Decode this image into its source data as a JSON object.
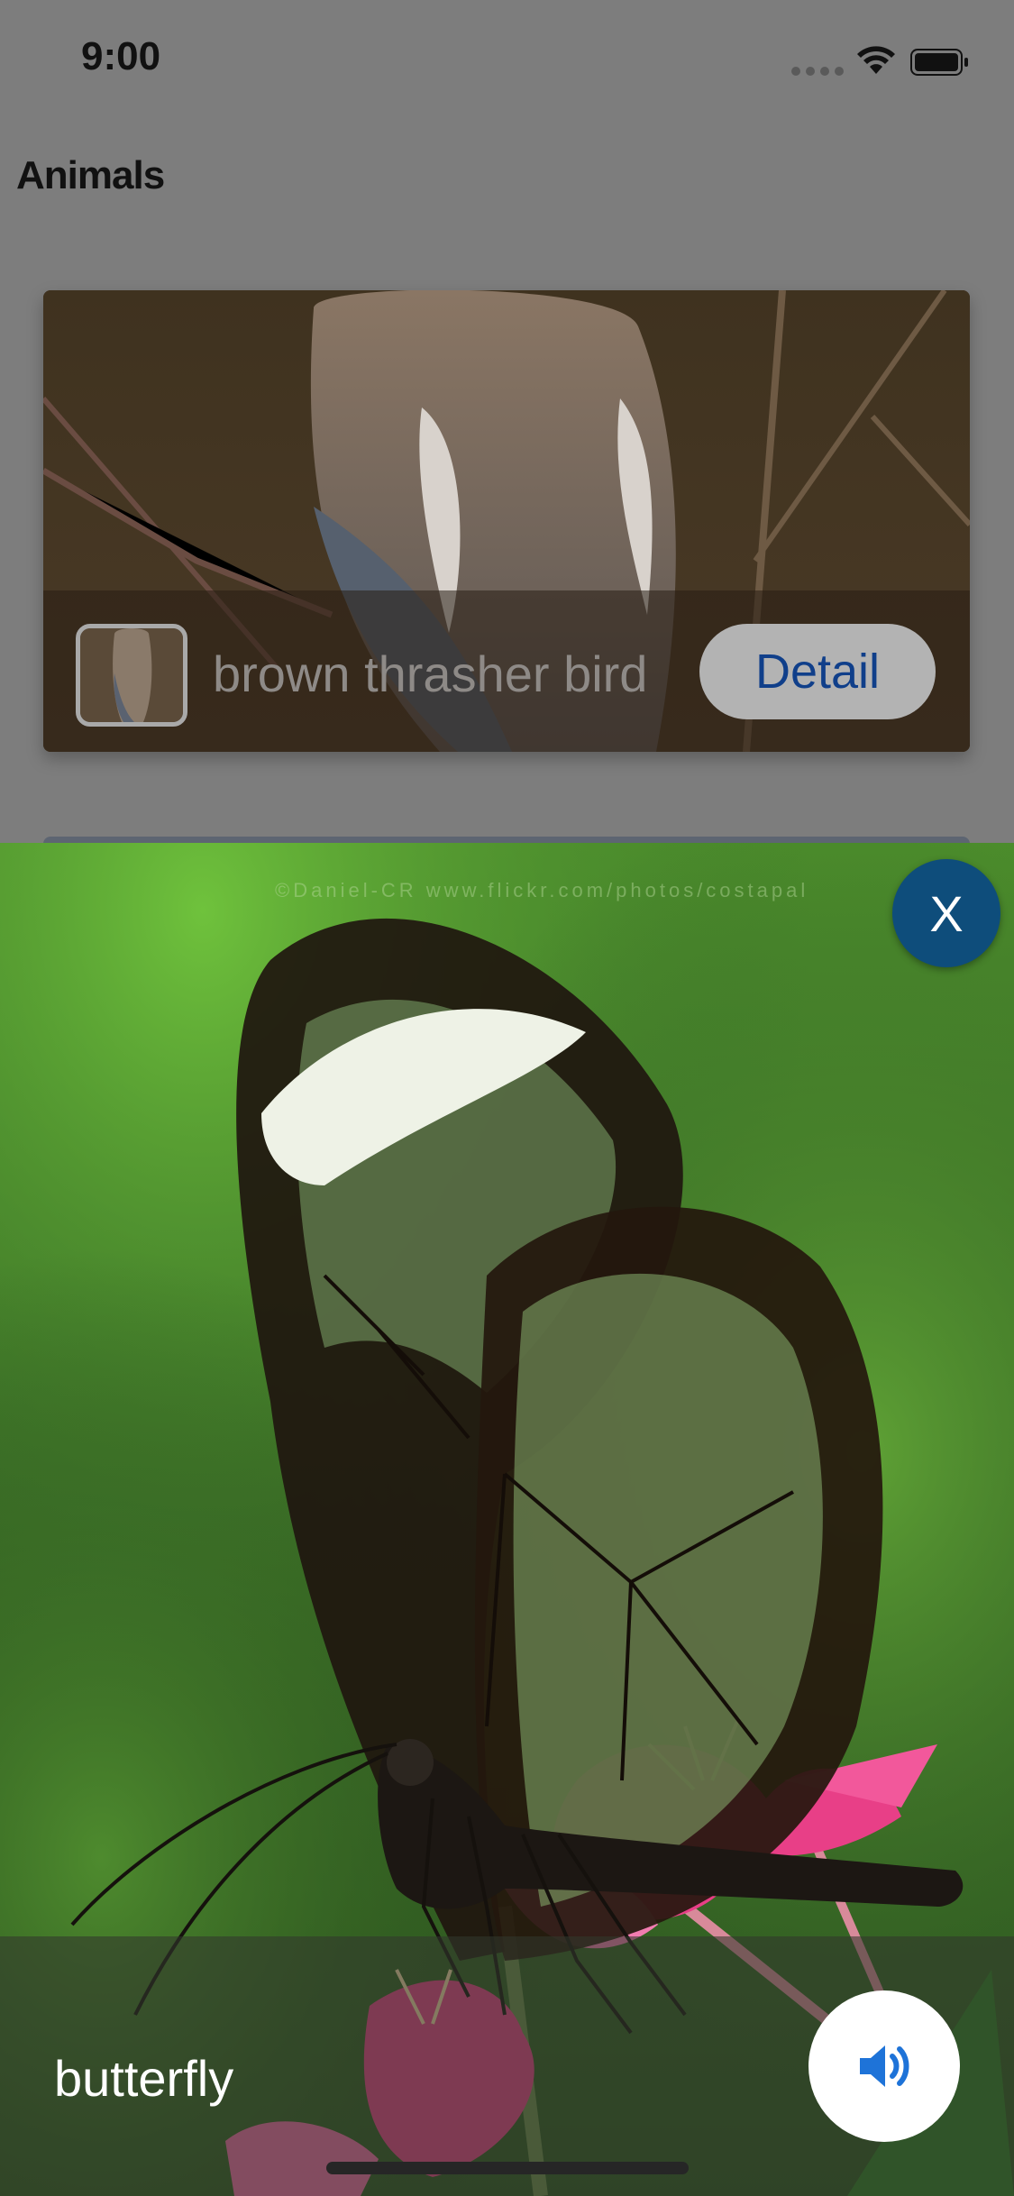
{
  "status_bar": {
    "time": "9:00"
  },
  "nav": {
    "title": "Animals"
  },
  "cards": [
    {
      "title": "brown thrasher bird",
      "detail_label": "Detail"
    }
  ],
  "overlay": {
    "title": "butterfly",
    "close_label": "X",
    "image_watermark": "©Daniel-CR www.flickr.com/photos/costapal"
  },
  "colors": {
    "accent": "#103f8a",
    "close_button": "#0e4d7b",
    "sound_icon": "#1e73d8"
  },
  "icons": {
    "sound": "speaker-icon",
    "wifi": "wifi-icon",
    "battery": "battery-icon",
    "signal": "signal-icon"
  }
}
